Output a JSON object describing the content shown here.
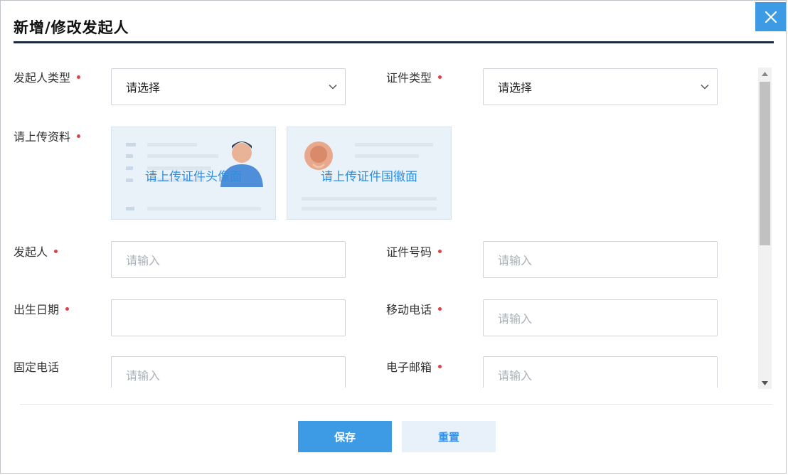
{
  "dialog": {
    "title": "新增/修改发起人",
    "close_icon": "close-icon"
  },
  "form": {
    "initiator_type": {
      "label": "发起人类型",
      "required": true,
      "value": "请选择"
    },
    "id_type": {
      "label": "证件类型",
      "required": true,
      "value": "请选择"
    },
    "upload": {
      "label": "请上传资料",
      "required": true,
      "front_caption": "请上传证件头像面",
      "back_caption": "请上传证件国徽面"
    },
    "initiator": {
      "label": "发起人",
      "required": true,
      "placeholder": "请输入"
    },
    "id_number": {
      "label": "证件号码",
      "required": true,
      "placeholder": "请输入"
    },
    "birth_date": {
      "label": "出生日期",
      "required": true,
      "placeholder": ""
    },
    "mobile": {
      "label": "移动电话",
      "required": true,
      "placeholder": "请输入"
    },
    "landline": {
      "label": "固定电话",
      "required": false,
      "placeholder": "请输入"
    },
    "email": {
      "label": "电子邮箱",
      "required": true,
      "placeholder": "请输入"
    }
  },
  "footer": {
    "save_label": "保存",
    "reset_label": "重置"
  },
  "colors": {
    "accent": "#3c9be4",
    "required_dot": "#e0404a",
    "title_rule": "#1c2b3f"
  }
}
